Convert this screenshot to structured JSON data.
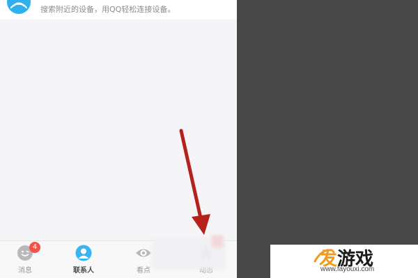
{
  "device_section": {
    "description": "搜索附近的设备，用QQ轻松连接设备。",
    "icon": "wifi-signal-icon",
    "icon_color": "#2fb0ef"
  },
  "tabbar": {
    "tabs": [
      {
        "label": "消息",
        "icon": "chat-face-icon",
        "badge": "4",
        "active": false
      },
      {
        "label": "联系人",
        "icon": "contact-person-icon",
        "active": true
      },
      {
        "label": "看点",
        "icon": "eye-icon",
        "active": false
      },
      {
        "label": "动态",
        "icon": "star-icon",
        "active": false
      }
    ],
    "badge_color": "#f25247",
    "active_color": "#2fb0ef"
  },
  "annotation": {
    "type": "red-arrow",
    "color": "#b5221b",
    "points_to": "动态"
  },
  "watermark": {
    "logo_accent": "发",
    "logo_rest": "游戏",
    "url": "www.fayouxi.com",
    "accent_color": "#f29a1a"
  }
}
